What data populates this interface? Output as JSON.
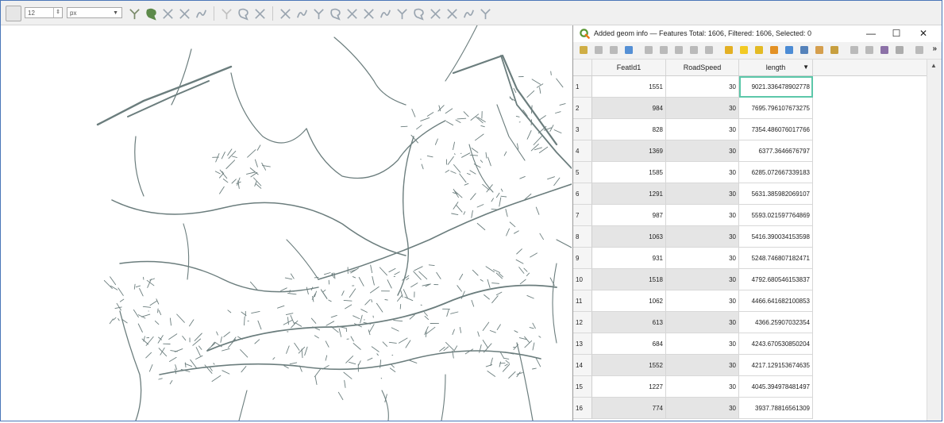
{
  "toolbar": {
    "size_value": "12",
    "unit_value": "px",
    "icons": [
      "select-feature-icon",
      "digitize-icon",
      "delete-icon",
      "split-icon",
      "reshape-icon",
      "node-tool-icon",
      "rotate-icon",
      "simplify-icon",
      "add-ring-icon",
      "add-part-icon",
      "fill-ring-icon",
      "delete-ring-icon",
      "delete-part-icon",
      "reshape-features-icon",
      "offset-curve-icon",
      "split-features-icon",
      "split-parts-icon",
      "merge-features-icon",
      "merge-attributes-icon",
      "rotate-point-icon",
      "tracing-icon"
    ]
  },
  "window": {
    "title": "Added geom info — Features Total: 1606, Filtered: 1606, Selected: 0",
    "minimize": "—",
    "maximize": "☐",
    "close": "✕"
  },
  "table": {
    "columns": [
      "FeatId1",
      "RoadSpeed",
      "length"
    ],
    "sort_indicator": "▼",
    "rows": [
      {
        "n": "1",
        "featid": "1551",
        "speed": "30",
        "length": "9021.336478902778"
      },
      {
        "n": "2",
        "featid": "984",
        "speed": "30",
        "length": "7695.796107673275"
      },
      {
        "n": "3",
        "featid": "828",
        "speed": "30",
        "length": "7354.486076017766"
      },
      {
        "n": "4",
        "featid": "1369",
        "speed": "30",
        "length": "6377.3646676797"
      },
      {
        "n": "5",
        "featid": "1585",
        "speed": "30",
        "length": "6285.072667339183"
      },
      {
        "n": "6",
        "featid": "1291",
        "speed": "30",
        "length": "5631.385982069107"
      },
      {
        "n": "7",
        "featid": "987",
        "speed": "30",
        "length": "5593.021597764869"
      },
      {
        "n": "8",
        "featid": "1063",
        "speed": "30",
        "length": "5416.390034153598"
      },
      {
        "n": "9",
        "featid": "931",
        "speed": "30",
        "length": "5248.746807182471"
      },
      {
        "n": "10",
        "featid": "1518",
        "speed": "30",
        "length": "4792.680546153837"
      },
      {
        "n": "11",
        "featid": "1062",
        "speed": "30",
        "length": "4466.641682100853"
      },
      {
        "n": "12",
        "featid": "613",
        "speed": "30",
        "length": "4366.25907032354"
      },
      {
        "n": "13",
        "featid": "684",
        "speed": "30",
        "length": "4243.670530850204"
      },
      {
        "n": "14",
        "featid": "1552",
        "speed": "30",
        "length": "4217.129153674635"
      },
      {
        "n": "15",
        "featid": "1227",
        "speed": "30",
        "length": "4045.394978481497"
      },
      {
        "n": "16",
        "featid": "774",
        "speed": "30",
        "length": "3937.78816561309"
      }
    ]
  },
  "colors": {
    "road": "#6b7d7d",
    "selection_outline": "#5cc7a9",
    "alt_row": "#e5e5e5"
  }
}
